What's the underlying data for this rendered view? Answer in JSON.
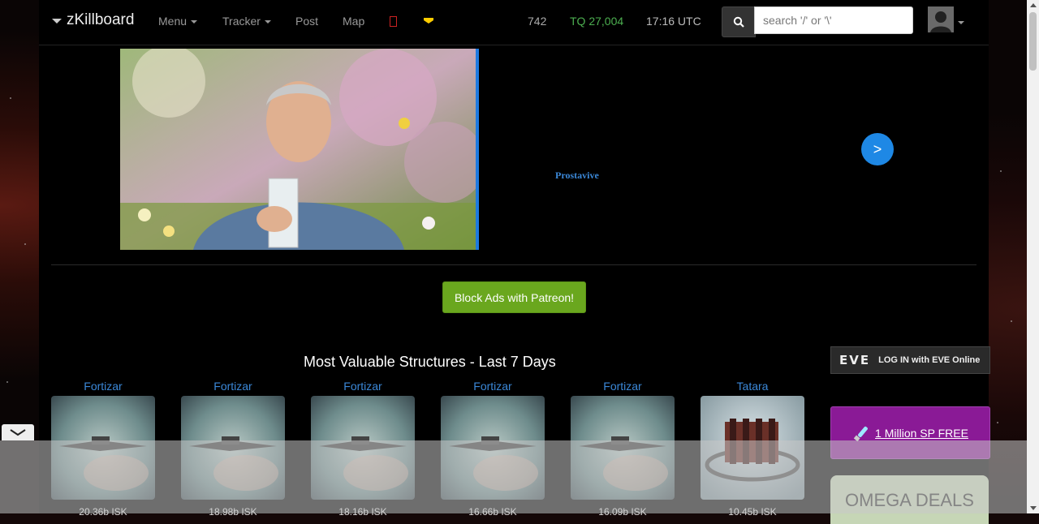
{
  "navbar": {
    "brand": "zKillboard",
    "menu_label": "Menu",
    "tracker_label": "Tracker",
    "post_label": "Post",
    "map_label": "Map",
    "stats": {
      "count": "742",
      "tq": "TQ 27,004",
      "time": "17:16 UTC"
    },
    "stat_colors": {
      "count": "#aaaaaa",
      "tq": "#4caf50",
      "time": "#bbbbbb"
    },
    "search_placeholder": "search '/' or '\\'"
  },
  "ad": {
    "link_text": "Prostavive",
    "next_label": ">"
  },
  "patreon_button": "Block Ads with Patreon!",
  "structures": {
    "title": "Most Valuable Structures - Last 7 Days",
    "items": [
      {
        "name": "Fortizar",
        "price": "20.36b ISK"
      },
      {
        "name": "Fortizar",
        "price": "18.98b ISK"
      },
      {
        "name": "Fortizar",
        "price": "18.16b ISK"
      },
      {
        "name": "Fortizar",
        "price": "16.66b ISK"
      },
      {
        "name": "Fortizar",
        "price": "16.09b ISK"
      },
      {
        "name": "Tatara",
        "price": "10.45b ISK"
      }
    ]
  },
  "sidebar": {
    "eve_logo": "EVE",
    "eve_login": "LOG IN with EVE Online",
    "sp_link": "1 Million SP FREE",
    "omega": "OMEGA DEALS"
  }
}
